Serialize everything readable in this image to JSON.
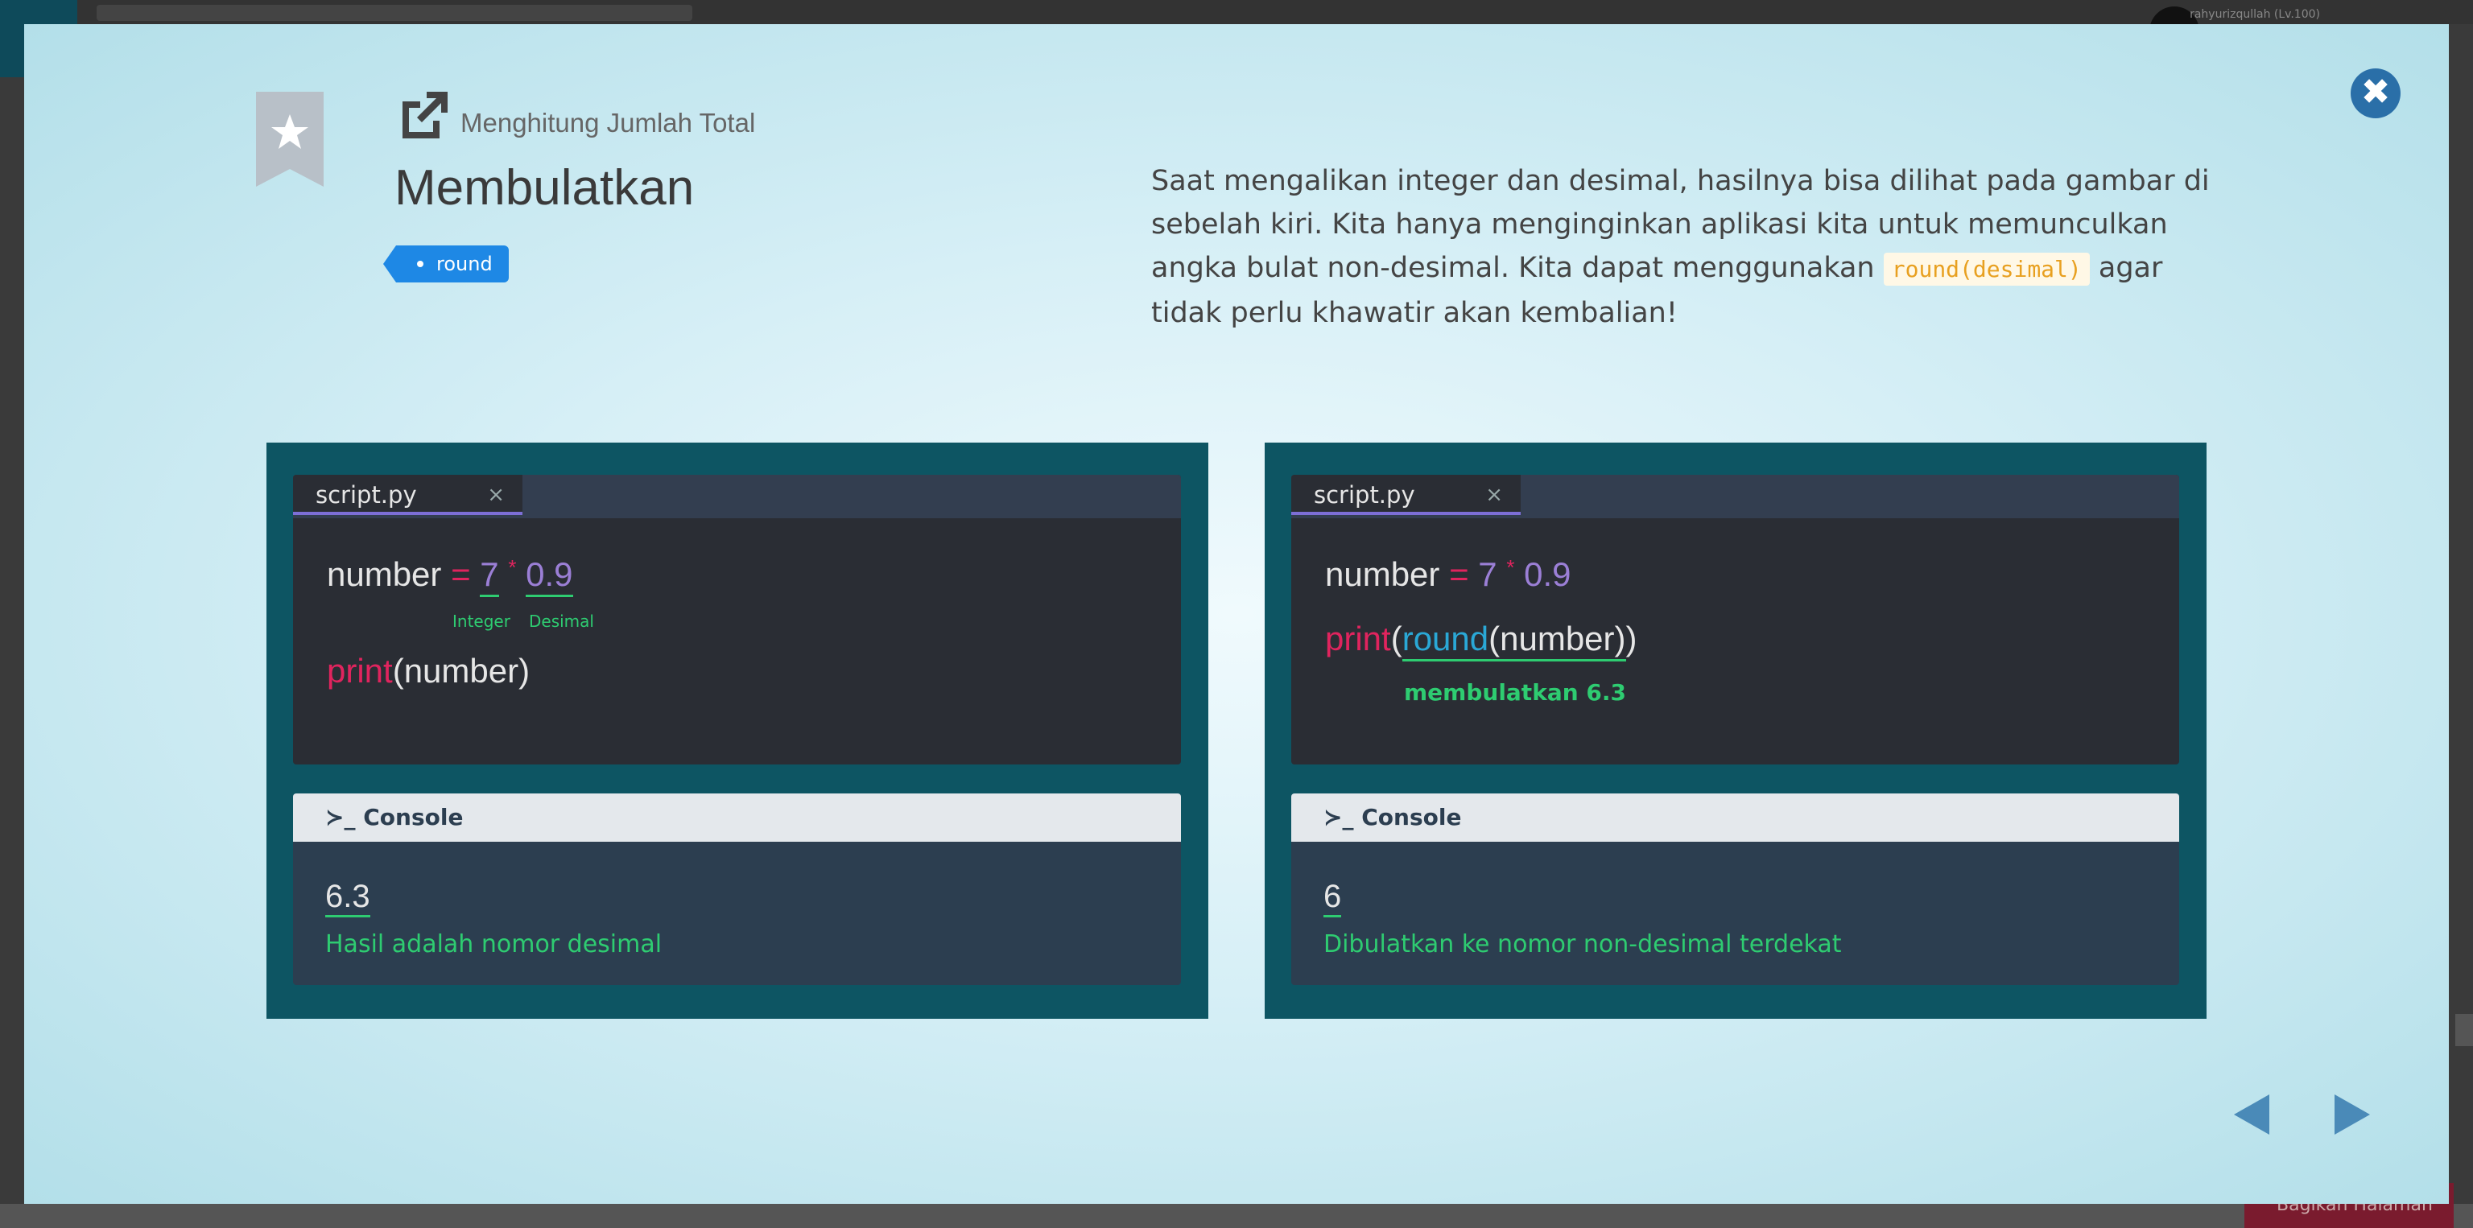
{
  "background": {
    "username": "rahyurizqullah (Lv.100)",
    "share_label": "Bagikan Halaman"
  },
  "header": {
    "subtitle": "Menghitung Jumlah Total",
    "title": "Membulatkan",
    "tag": "round"
  },
  "description": {
    "text_before": "Saat mengalikan integer dan desimal, hasilnya bisa dilihat pada gambar di sebelah kiri. Kita hanya menginginkan aplikasi kita untuk memunculkan angka bulat non-desimal. Kita dapat menggunakan ",
    "code": "round(desimal)",
    "text_after": " agar tidak perlu khawatir akan kembalian!"
  },
  "left_panel": {
    "tab": "script.py",
    "tab_close": "×",
    "line1_var": "number",
    "line1_eq": "=",
    "line1_int": "7",
    "line1_mul": "*",
    "line1_dec": "0.9",
    "annot_integer": "Integer",
    "annot_desimal": "Desimal",
    "line2_fn": "print",
    "line2_args": "(number)",
    "console_label": "Console",
    "console_output": "6.3",
    "console_note": "Hasil adalah nomor desimal"
  },
  "right_panel": {
    "tab": "script.py",
    "tab_close": "×",
    "line1_var": "number",
    "line1_eq": "=",
    "line1_int": "7",
    "line1_mul": "*",
    "line1_dec": "0.9",
    "line2_fn": "print",
    "line2_open": "(",
    "line2_round": "round",
    "line2_inner": "(number)",
    "line2_close": ")",
    "annot_round": "membulatkan 6.3",
    "console_label": "Console",
    "console_output": "6",
    "console_note": "Dibulatkan ke nomor non-desimal terdekat"
  },
  "colors": {
    "accent": "#1e88e5",
    "panel_bg": "#0d5563",
    "highlight_green": "#2ecc71",
    "keyword_red": "#e0245e"
  }
}
